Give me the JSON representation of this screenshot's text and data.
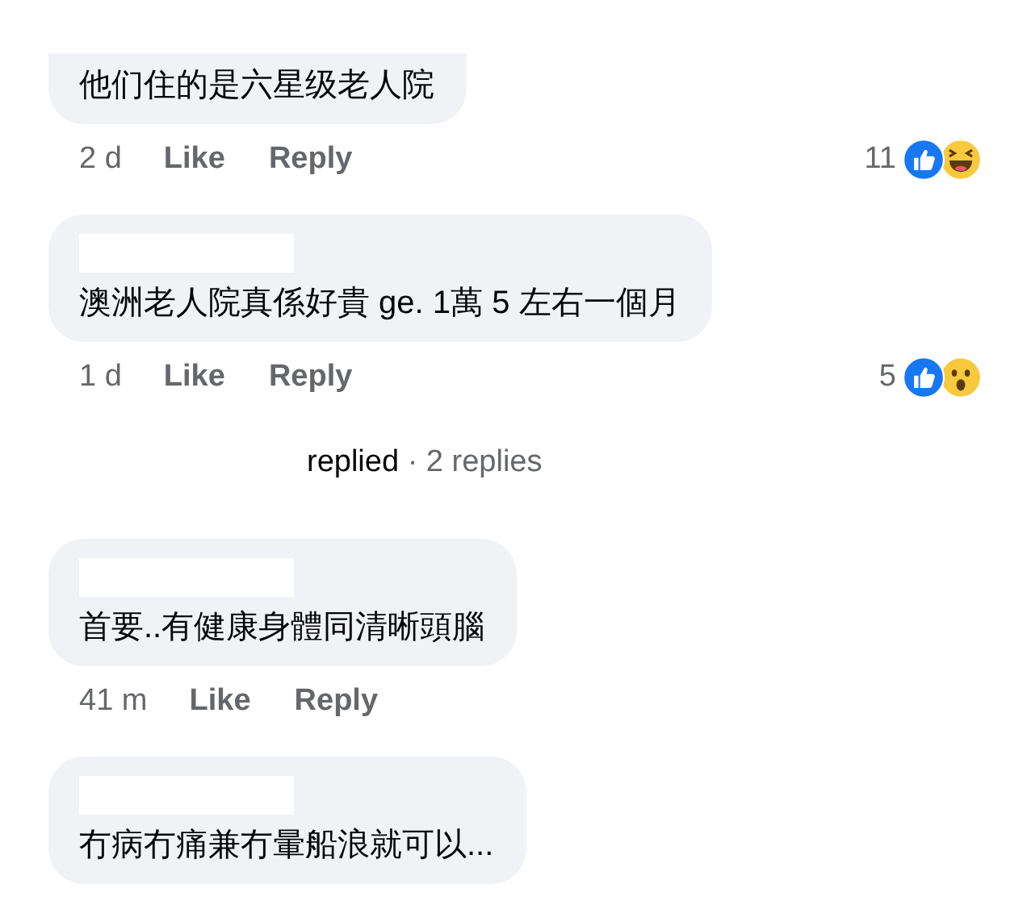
{
  "comments": [
    {
      "cut_top": true,
      "text": "他们住的是六星级老人院",
      "time": "2 d",
      "like": "Like",
      "reply": "Reply",
      "reaction_count": "11",
      "reactions": [
        {
          "kind": "like"
        },
        {
          "kind": "haha"
        }
      ]
    },
    {
      "author_hidden": true,
      "cut_top": false,
      "text": "澳洲老人院真係好貴 ge. 1萬 5 左右一個月",
      "time": "1 d",
      "like": "Like",
      "reply": "Reply",
      "reaction_count": "5",
      "reactions": [
        {
          "kind": "like"
        },
        {
          "kind": "wow"
        }
      ],
      "replies": {
        "label": "replied",
        "count": "· 2 replies"
      }
    },
    {
      "author_hidden": true,
      "cut_top": false,
      "text": "首要..有健康身體同清晰頭腦",
      "time": "41 m",
      "like": "Like",
      "reply": "Reply"
    },
    {
      "author_hidden": true,
      "cut_top": false,
      "text": "冇病冇痛兼冇暈船浪就可以..."
    }
  ]
}
